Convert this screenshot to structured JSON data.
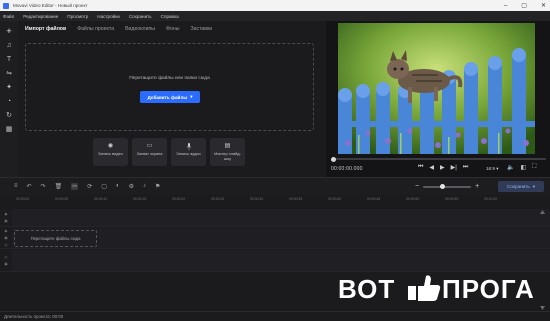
{
  "window": {
    "title": "Movavi Video Editor - Новый проект"
  },
  "menu": [
    "Файл",
    "Редактирование",
    "Просмотр",
    "Настройки",
    "Сохранить",
    "Справка"
  ],
  "rail": [
    {
      "icon": "plus-icon",
      "glyph": "+"
    },
    {
      "icon": "music-icon",
      "glyph": "♫"
    },
    {
      "icon": "text-icon",
      "glyph": "T"
    },
    {
      "icon": "transitions-icon",
      "glyph": "⇋"
    },
    {
      "icon": "effects-icon",
      "glyph": "✦"
    },
    {
      "icon": "stickers-icon",
      "glyph": "◔"
    },
    {
      "icon": "more-tools-icon",
      "glyph": "↻"
    },
    {
      "icon": "tools-icon",
      "glyph": "▦"
    }
  ],
  "library": {
    "tabs": [
      "Импорт файлов",
      "Файлы проекта",
      "Видеоклипы",
      "Фоны",
      "Заставки"
    ],
    "active_tab": 0,
    "drop_text": "Перетащите файлы или папки сюда",
    "add_button": "Добавить файлы"
  },
  "cards": [
    {
      "icon": "record-video-icon",
      "glyph": "◉",
      "label": "Запись видео"
    },
    {
      "icon": "screen-capture-icon",
      "glyph": "▭",
      "label": "Захват экрана"
    },
    {
      "icon": "microphone-icon",
      "glyph": "🎙",
      "label": "Запись аудио"
    },
    {
      "icon": "slideshow-icon",
      "glyph": "▤",
      "label": "Мастер слайд-шоу"
    }
  ],
  "preview": {
    "timecode": "00:00:00.000",
    "aspect_ratio": "16:9",
    "seek_progress": 0
  },
  "timeline": {
    "export_button": "Сохранить",
    "zoom_level": 0.4,
    "ruler": [
      "00:00:00",
      "00:00:05",
      "00:00:10",
      "00:00:15",
      "00:00:20",
      "00:00:25",
      "00:00:30",
      "00:00:35",
      "00:00:40",
      "00:00:45",
      "00:00:50",
      "00:00:55",
      "00:01:00"
    ],
    "drop_text": "Перетащите файлы сюда"
  },
  "status": {
    "duration": "Длительность проекта: 00:00"
  },
  "watermark": {
    "left": "ВОТ",
    "right": "ПРОГА"
  },
  "colors": {
    "accent": "#2b6cff",
    "background": "#1b1b1d",
    "watermark": "#ffffff"
  }
}
